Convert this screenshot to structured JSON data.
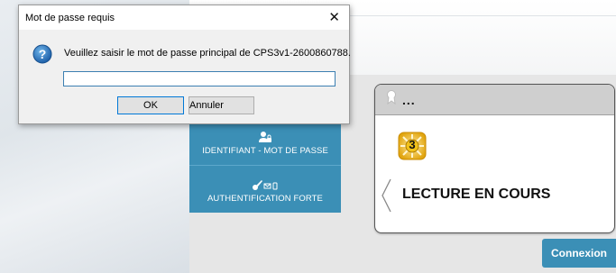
{
  "dialog": {
    "title": "Mot de passe requis",
    "message": "Veuillez saisir le mot de passe principal de CPS3v1-2600860788.",
    "password_value": "",
    "ok_label": "OK",
    "cancel_label": "Annuler",
    "icons": {
      "close": "close-icon",
      "question": "question-icon"
    }
  },
  "menu": {
    "items": [
      {
        "label": "IDENTIFIANT - MOT DE PASSE",
        "icon": "user-lock-icon"
      },
      {
        "label": "AUTHENTIFICATION FORTE",
        "icon": "key-envelope-phone-icon"
      }
    ]
  },
  "reader": {
    "header_text": "...",
    "status": "LECTURE EN COURS",
    "badge_number": "3",
    "icons": {
      "header": "award-ribbon-icon",
      "back": "chevron-left-icon"
    }
  },
  "connexion": {
    "label": "Connexion"
  },
  "colors": {
    "accent": "#3b8fb6",
    "dialog_bg": "#f0f0f0",
    "panel_header": "#cfcfcf"
  }
}
